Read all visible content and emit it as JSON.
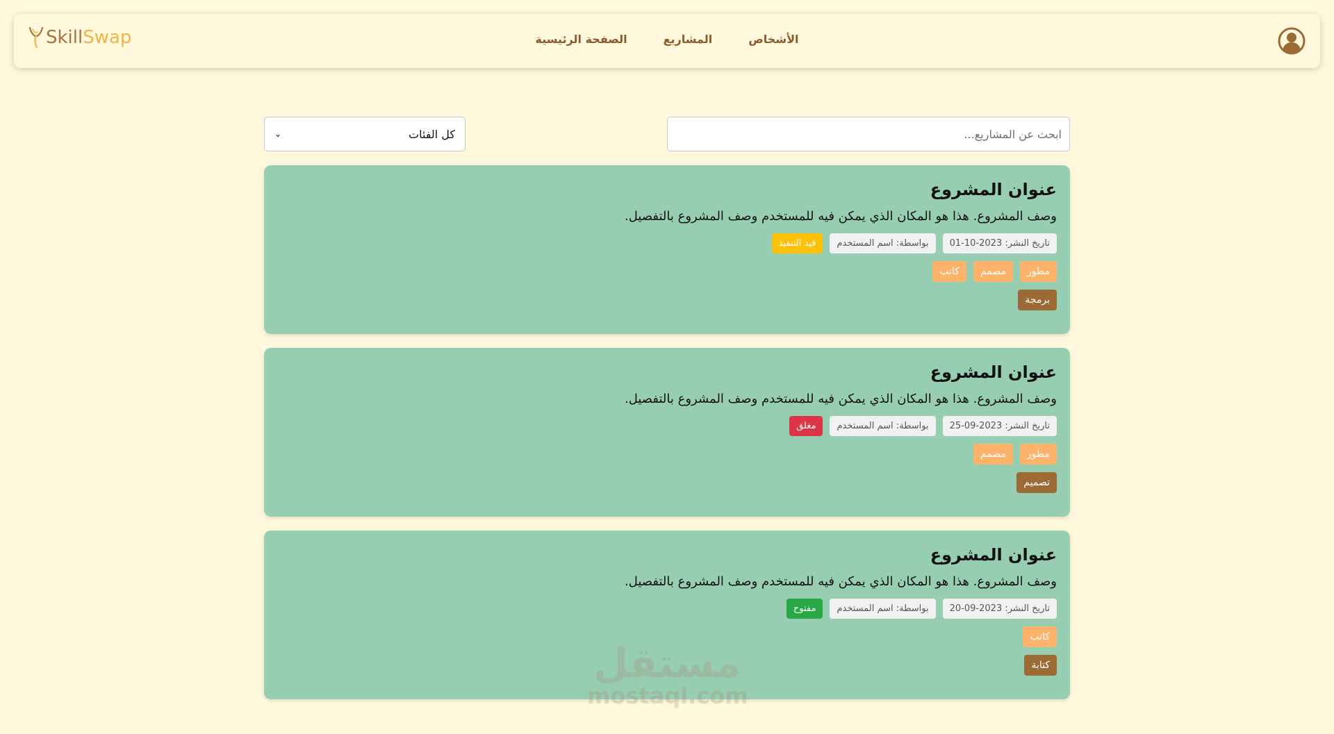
{
  "nav": {
    "logo_prefix": "Skill",
    "logo_suffix": "Swap",
    "links": [
      "الأشخاص",
      "المشاريع",
      "الصفحة الرئيسية"
    ]
  },
  "filters": {
    "search_placeholder": "ابحث عن المشاريع...",
    "category_selected": "كل الفئات"
  },
  "projects": [
    {
      "title": "عنوان المشروع",
      "description": "وصف المشروع. هذا هو المكان الذي يمكن فيه للمستخدم وصف المشروع بالتفصيل.",
      "date": "تاريخ النشر: 2023-10-01",
      "author": "بواسطة: اسم المستخدم",
      "status": "قيد التنفيذ",
      "status_color": "#ffc107",
      "skills": [
        "مطور",
        "مصمم",
        "كاتب"
      ],
      "category": "برمجة"
    },
    {
      "title": "عنوان المشروع",
      "description": "وصف المشروع. هذا هو المكان الذي يمكن فيه للمستخدم وصف المشروع بالتفصيل.",
      "date": "تاريخ النشر: 2023-09-25",
      "author": "بواسطة: اسم المستخدم",
      "status": "مغلق",
      "status_color": "#dc3545",
      "skills": [
        "مطور",
        "مصمم"
      ],
      "category": "تصميم"
    },
    {
      "title": "عنوان المشروع",
      "description": "وصف المشروع. هذا هو المكان الذي يمكن فيه للمستخدم وصف المشروع بالتفصيل.",
      "date": "تاريخ النشر: 2023-09-20",
      "author": "بواسطة: اسم المستخدم",
      "status": "مفتوح",
      "status_color": "#28a745",
      "skills": [
        "كاتب"
      ],
      "category": "كتابة"
    }
  ],
  "watermark": {
    "arabic": "مستقل",
    "latin": "mostaql.com"
  },
  "colors": {
    "background": "#fff8dc",
    "card": "#97ceb2",
    "brand": "#a6733a",
    "skill": "#ffb26a",
    "category": "#9b6a35"
  }
}
